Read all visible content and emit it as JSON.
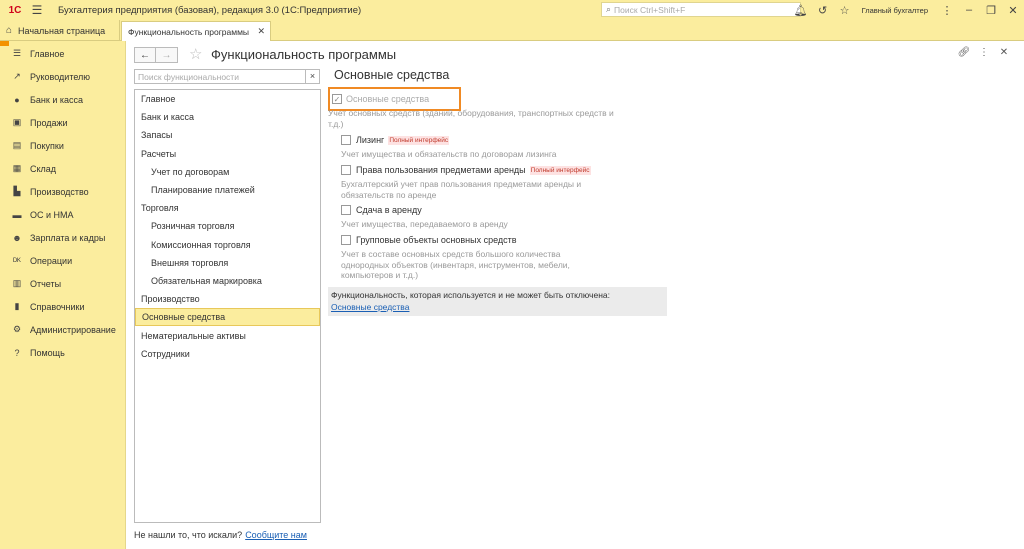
{
  "titlebar": {
    "logo": "1С",
    "title": "Бухгалтерия предприятия (базовая), редакция 3.0  (1С:Предприятие)",
    "search_placeholder": "Поиск Ctrl+Shift+F",
    "user": "Главный бухгалтер"
  },
  "tabs": {
    "home_label": "Начальная страница",
    "active_label": "Функциональность программы"
  },
  "sidebar": {
    "items": [
      {
        "label": "Главное",
        "icon": "list-icon"
      },
      {
        "label": "Руководителю",
        "icon": "trend-icon"
      },
      {
        "label": "Банк и касса",
        "icon": "coin-icon"
      },
      {
        "label": "Продажи",
        "icon": "bag-icon"
      },
      {
        "label": "Покупки",
        "icon": "cart-icon"
      },
      {
        "label": "Склад",
        "icon": "box-icon"
      },
      {
        "label": "Производство",
        "icon": "factory-icon"
      },
      {
        "label": "ОС и НМА",
        "icon": "truck-icon"
      },
      {
        "label": "Зарплата и кадры",
        "icon": "person-icon"
      },
      {
        "label": "Операции",
        "icon": "dt-kt-icon"
      },
      {
        "label": "Отчеты",
        "icon": "chart-icon"
      },
      {
        "label": "Справочники",
        "icon": "book-icon"
      },
      {
        "label": "Администрирование",
        "icon": "gear-icon"
      },
      {
        "label": "Помощь",
        "icon": "question-icon"
      }
    ]
  },
  "main": {
    "title": "Функциональность программы",
    "search_placeholder": "Поиск функциональности",
    "tree": [
      {
        "label": "Главное",
        "level": 0
      },
      {
        "label": "Банк и касса",
        "level": 0
      },
      {
        "label": "Запасы",
        "level": 0
      },
      {
        "label": "Расчеты",
        "level": 0
      },
      {
        "label": "Учет по договорам",
        "level": 1
      },
      {
        "label": "Планирование платежей",
        "level": 1
      },
      {
        "label": "Торговля",
        "level": 0
      },
      {
        "label": "Розничная торговля",
        "level": 1
      },
      {
        "label": "Комиссионная торговля",
        "level": 1
      },
      {
        "label": "Внешняя торговля",
        "level": 1
      },
      {
        "label": "Обязательная маркировка",
        "level": 1
      },
      {
        "label": "Производство",
        "level": 0
      },
      {
        "label": "Основные средства",
        "level": 0,
        "selected": true
      },
      {
        "label": "Нематериальные активы",
        "level": 0
      },
      {
        "label": "Сотрудники",
        "level": 0
      }
    ],
    "not_found_text": "Не нашли то, что искали?",
    "not_found_link": "Сообщите нам"
  },
  "section": {
    "title": "Основные средства",
    "main_option": {
      "label": "Основные средства",
      "checked": true,
      "description": "Учет основных средств (зданий, оборудования, транспортных средств и т.д.)"
    },
    "options": [
      {
        "label": "Лизинг",
        "badge": "Полный интерфейс",
        "description": "Учет имущества и обязательств  по договорам лизинга"
      },
      {
        "label": "Права пользования предметами аренды",
        "badge": "Полный интерфейс",
        "description": "Бухгалтерский учет прав пользования предметами аренды и обязательств по аренде"
      },
      {
        "label": "Сдача в аренду",
        "description": "Учет имущества, передаваемого в аренду"
      },
      {
        "label": "Групповые объекты основных средств",
        "description": "Учет в составе основных средств большого количества однородных объектов (инвентаря, инструментов, мебели, компьютеров и т.д.)"
      }
    ],
    "info_text": "Функциональность, которая используется и не может быть отключена:",
    "info_link": "Основные средства"
  }
}
